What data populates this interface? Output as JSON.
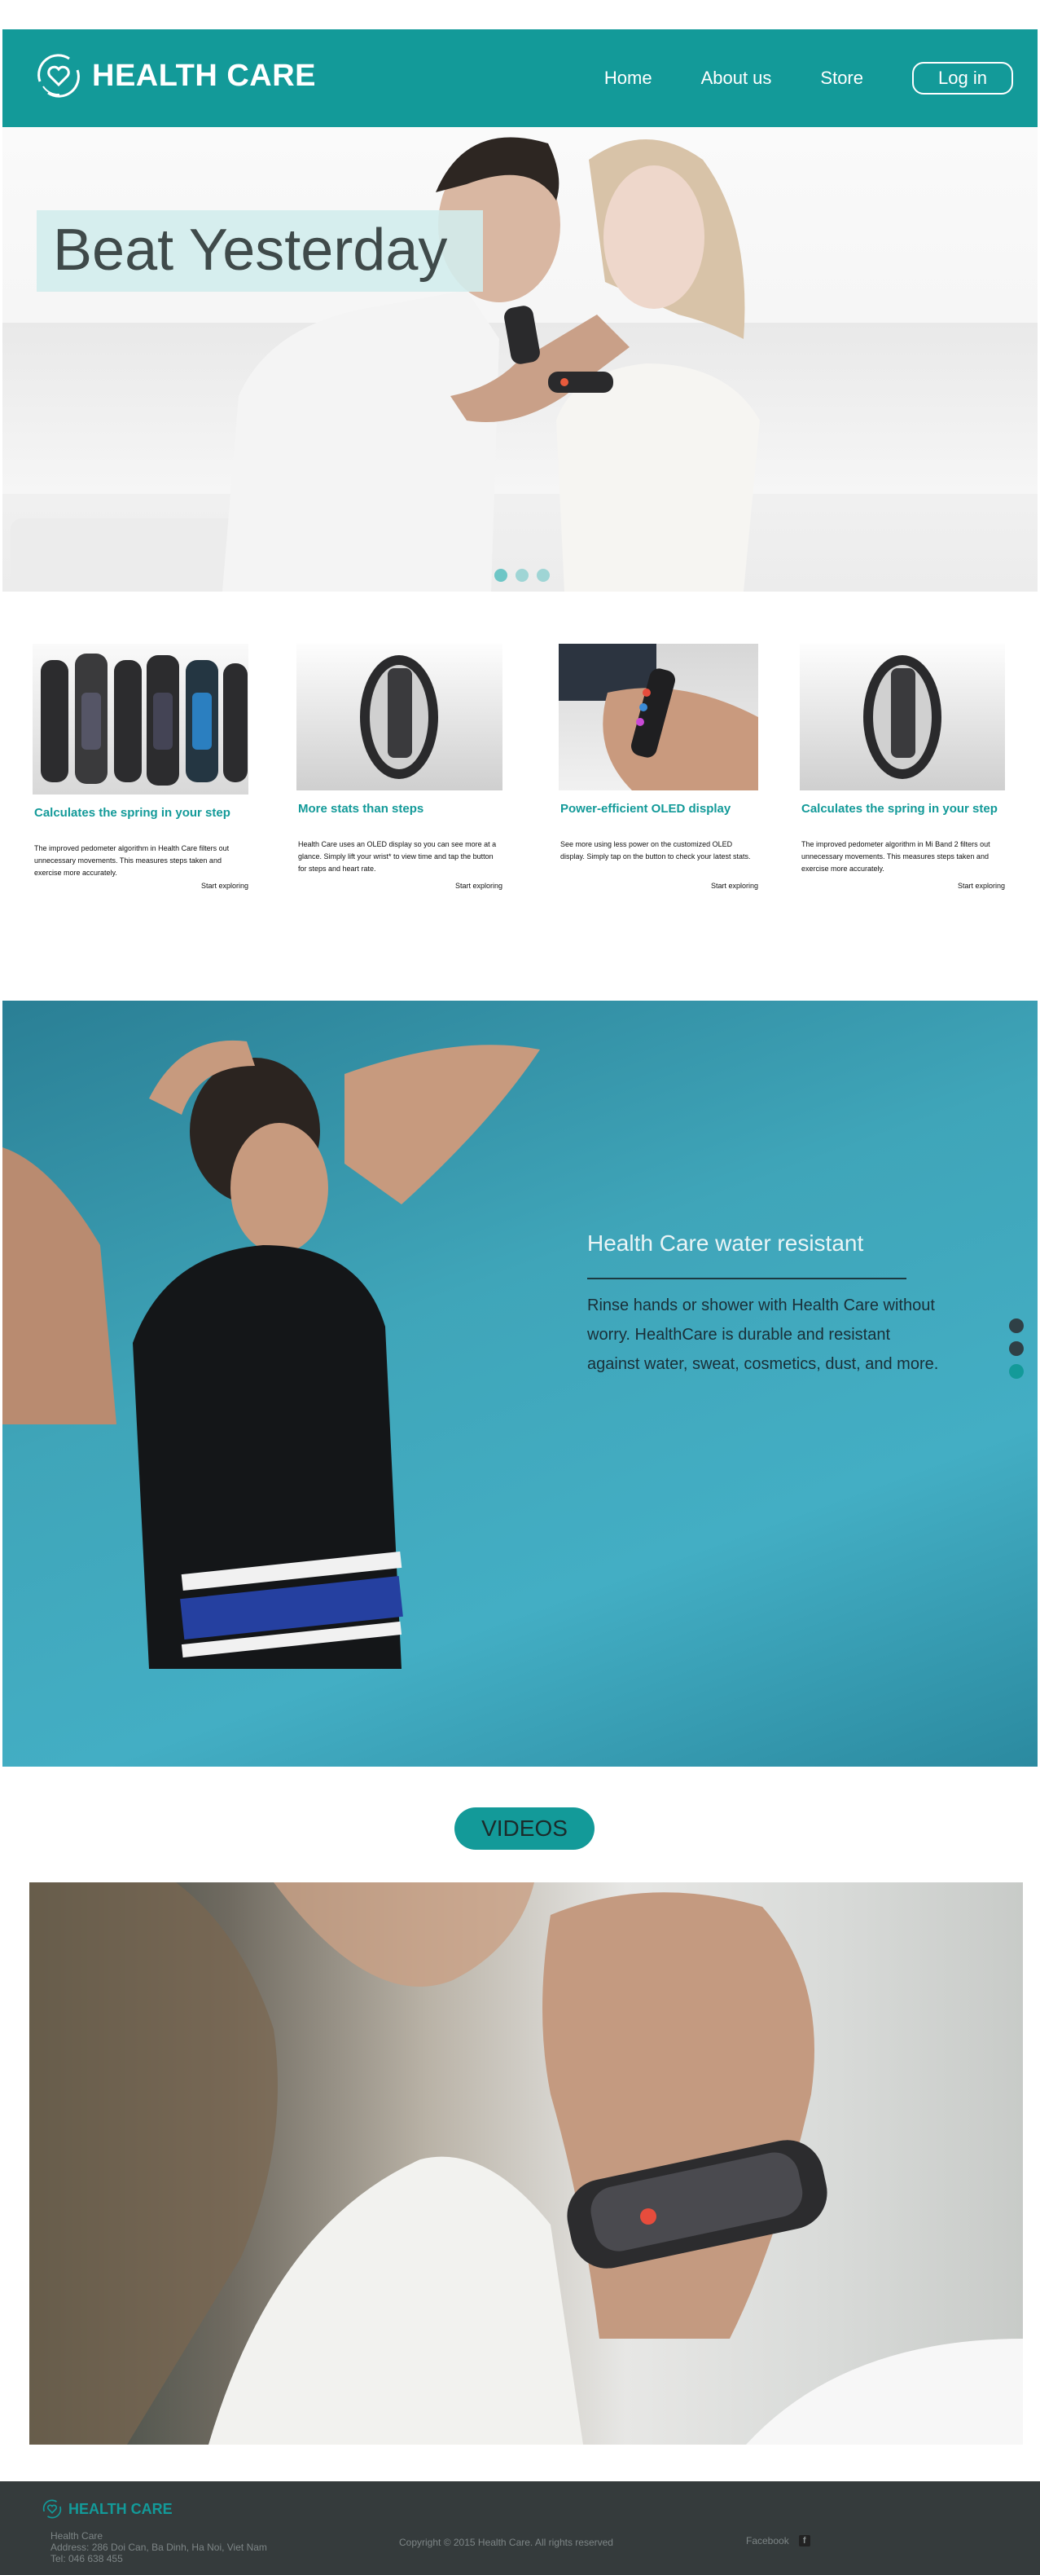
{
  "header": {
    "brand": "HEALTH CARE",
    "nav": [
      "Home",
      "About us",
      "Store"
    ],
    "login": "Log in"
  },
  "hero": {
    "title": "Beat Yesterday",
    "slides_count": 3
  },
  "features": [
    {
      "title": "Calculates the spring in your step",
      "text": "The improved pedometer algorithm in Health Care filters out unnecessary movements. This measures steps taken and exercise more accurately.",
      "link": "Start exploring"
    },
    {
      "title": "More stats than steps",
      "text": "Health Care uses an OLED display so you can see more at a glance. Simply lift your wrist* to view time and tap the button for steps and heart rate.",
      "link": "Start exploring"
    },
    {
      "title": "Power-efficient OLED display",
      "text": "See more using less power on the customized OLED display. Simply tap on the button to check your latest stats.",
      "link": "Start exploring"
    },
    {
      "title": "Calculates the spring in your step",
      "text": "The improved pedometer algorithm in Mi Band 2 filters out unnecessary movements. This measures steps taken and exercise more accurately.",
      "link": "Start exploring"
    }
  ],
  "water": {
    "title": "Health Care water resistant",
    "text": "Rinse hands or shower with Health Care without worry. HealthCare is durable and resistant against water, sweat, cosmetics, dust, and more."
  },
  "videos": {
    "label": "VIDEOS"
  },
  "footer": {
    "brand": "HEALTH CARE",
    "company": "Health Care",
    "address": "Address: 286 Doi Can, Ba Dinh, Ha Noi, Viet Nam",
    "tel": "Tel: 046 638 455",
    "copyright": "Copyright © 2015 Health Care. All rights reserved",
    "social": "Facebook"
  },
  "colors": {
    "brand_teal": "#139a99",
    "footer_bg": "#353b3c"
  }
}
